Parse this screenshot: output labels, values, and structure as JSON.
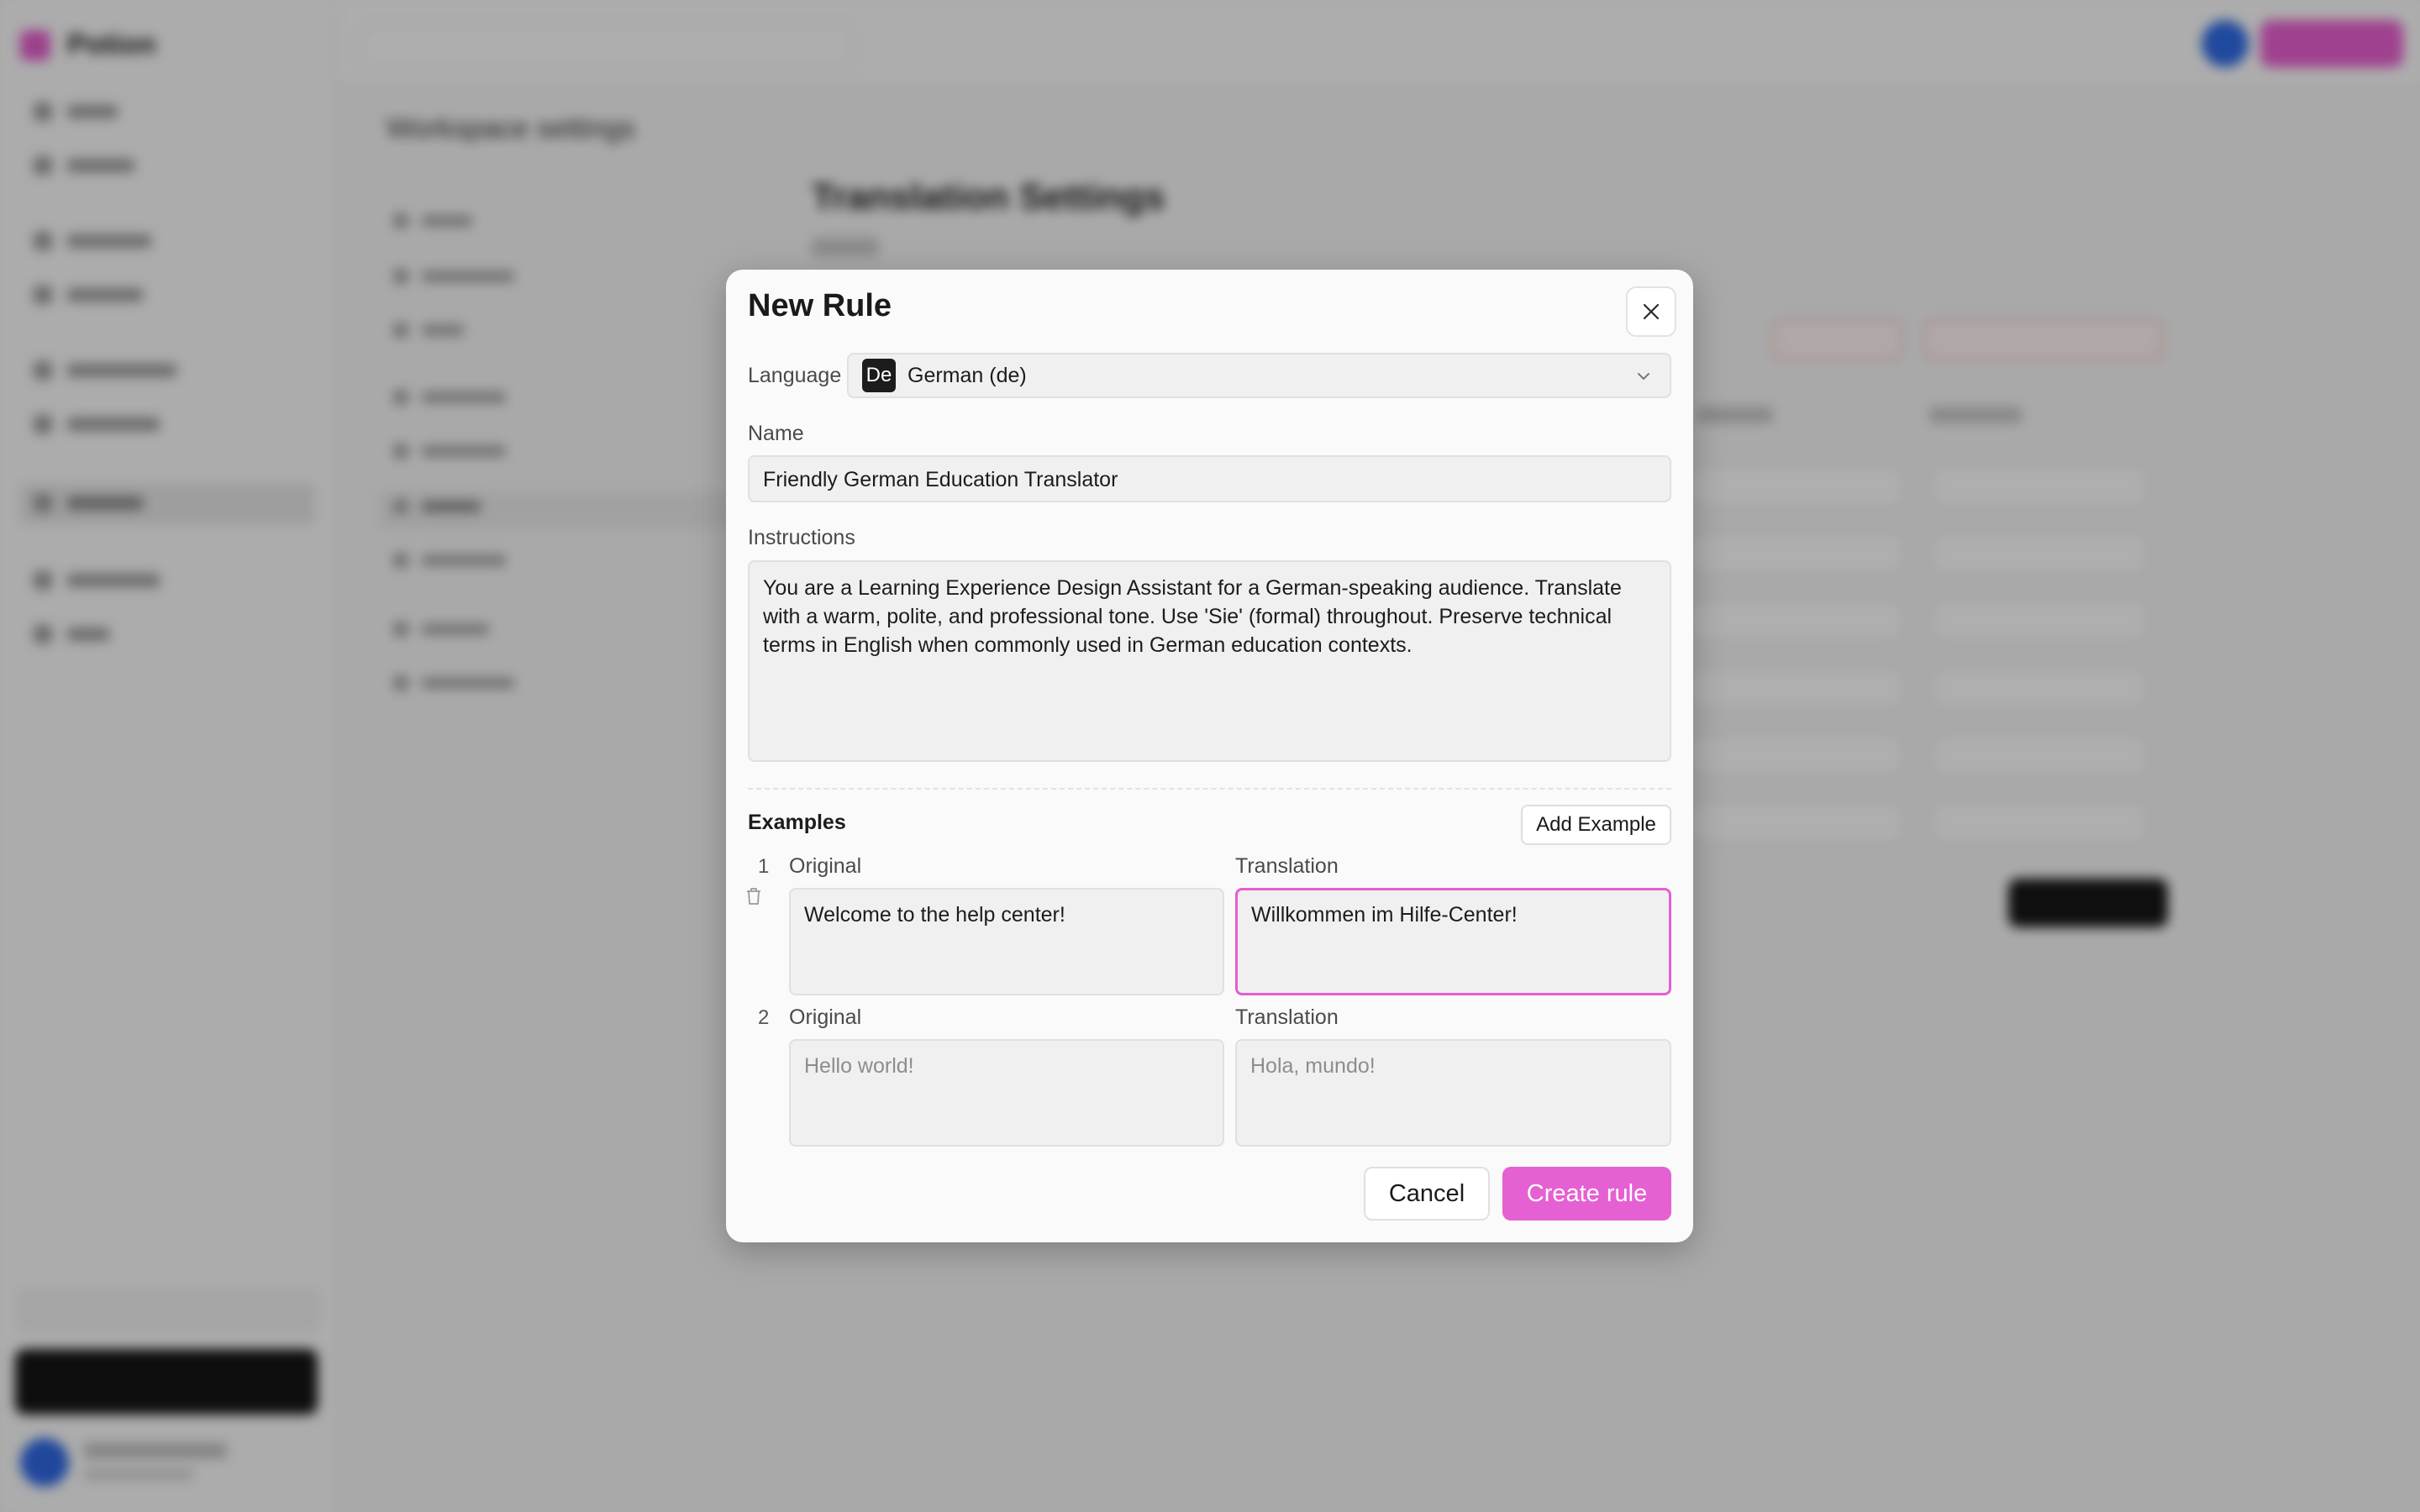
{
  "background": {
    "brand_name": "Potion",
    "page_heading": "Workspace settings",
    "main_title": "Translation Settings"
  },
  "modal": {
    "title": "New Rule",
    "close_icon": "close-icon",
    "language": {
      "label": "Language",
      "badge": "De",
      "value": "German (de)",
      "icon": "chevron-down-icon"
    },
    "name": {
      "label": "Name",
      "value": "Friendly German Education Translator"
    },
    "instructions": {
      "label": "Instructions",
      "value": "You are a Learning Experience Design Assistant for a German-speaking audience. Translate with a warm, polite, and professional tone. Use 'Sie' (formal) throughout. Preserve technical terms in English when commonly used in German education contexts."
    },
    "examples": {
      "title": "Examples",
      "add_label": "Add Example",
      "items": [
        {
          "number": "1",
          "original_label": "Original",
          "translation_label": "Translation",
          "original_value": "Welcome to the help center!",
          "translation_value": "Willkommen im Hilfe-Center!"
        },
        {
          "number": "2",
          "original_label": "Original",
          "translation_label": "Translation",
          "original_placeholder": "Hello world!",
          "translation_placeholder": "Hola, mundo!"
        }
      ]
    },
    "cancel_label": "Cancel",
    "create_label": "Create rule"
  },
  "colors": {
    "accent": "#e560d2",
    "overlay": "rgba(0,0,0,0.3)"
  }
}
